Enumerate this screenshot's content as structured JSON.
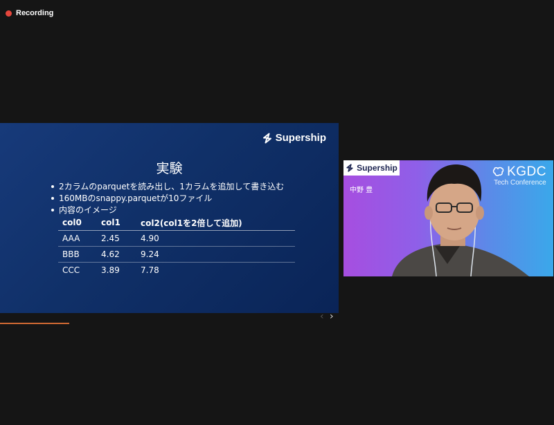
{
  "recording": {
    "label": "Recording"
  },
  "slide": {
    "brand": "Supership",
    "title": "実験",
    "bullets": [
      "2カラムのparquetを読み出し、1カラムを追加して書き込む",
      "160MBのsnappy.parquetが10ファイル",
      "内容のイメージ"
    ],
    "table": {
      "headers": [
        "col0",
        "col1",
        "col2(col1を2倍して追加)"
      ],
      "rows": [
        [
          "AAA",
          "2.45",
          "4.90"
        ],
        [
          "BBB",
          "4.62",
          "9.24"
        ],
        [
          "CCC",
          "3.89",
          "7.78"
        ]
      ]
    }
  },
  "navigation": {
    "prev_icon": "chevron-left-icon",
    "next_icon": "chevron-right-icon"
  },
  "video": {
    "brand": "Supership",
    "speaker_name": "中野 豊",
    "event": {
      "title": "KGDC",
      "subtitle": "Tech Conference"
    }
  },
  "colors": {
    "background": "#151515",
    "slide_bg": "#103068",
    "recording_dot": "#e5463c",
    "progress": "#d26a33"
  }
}
